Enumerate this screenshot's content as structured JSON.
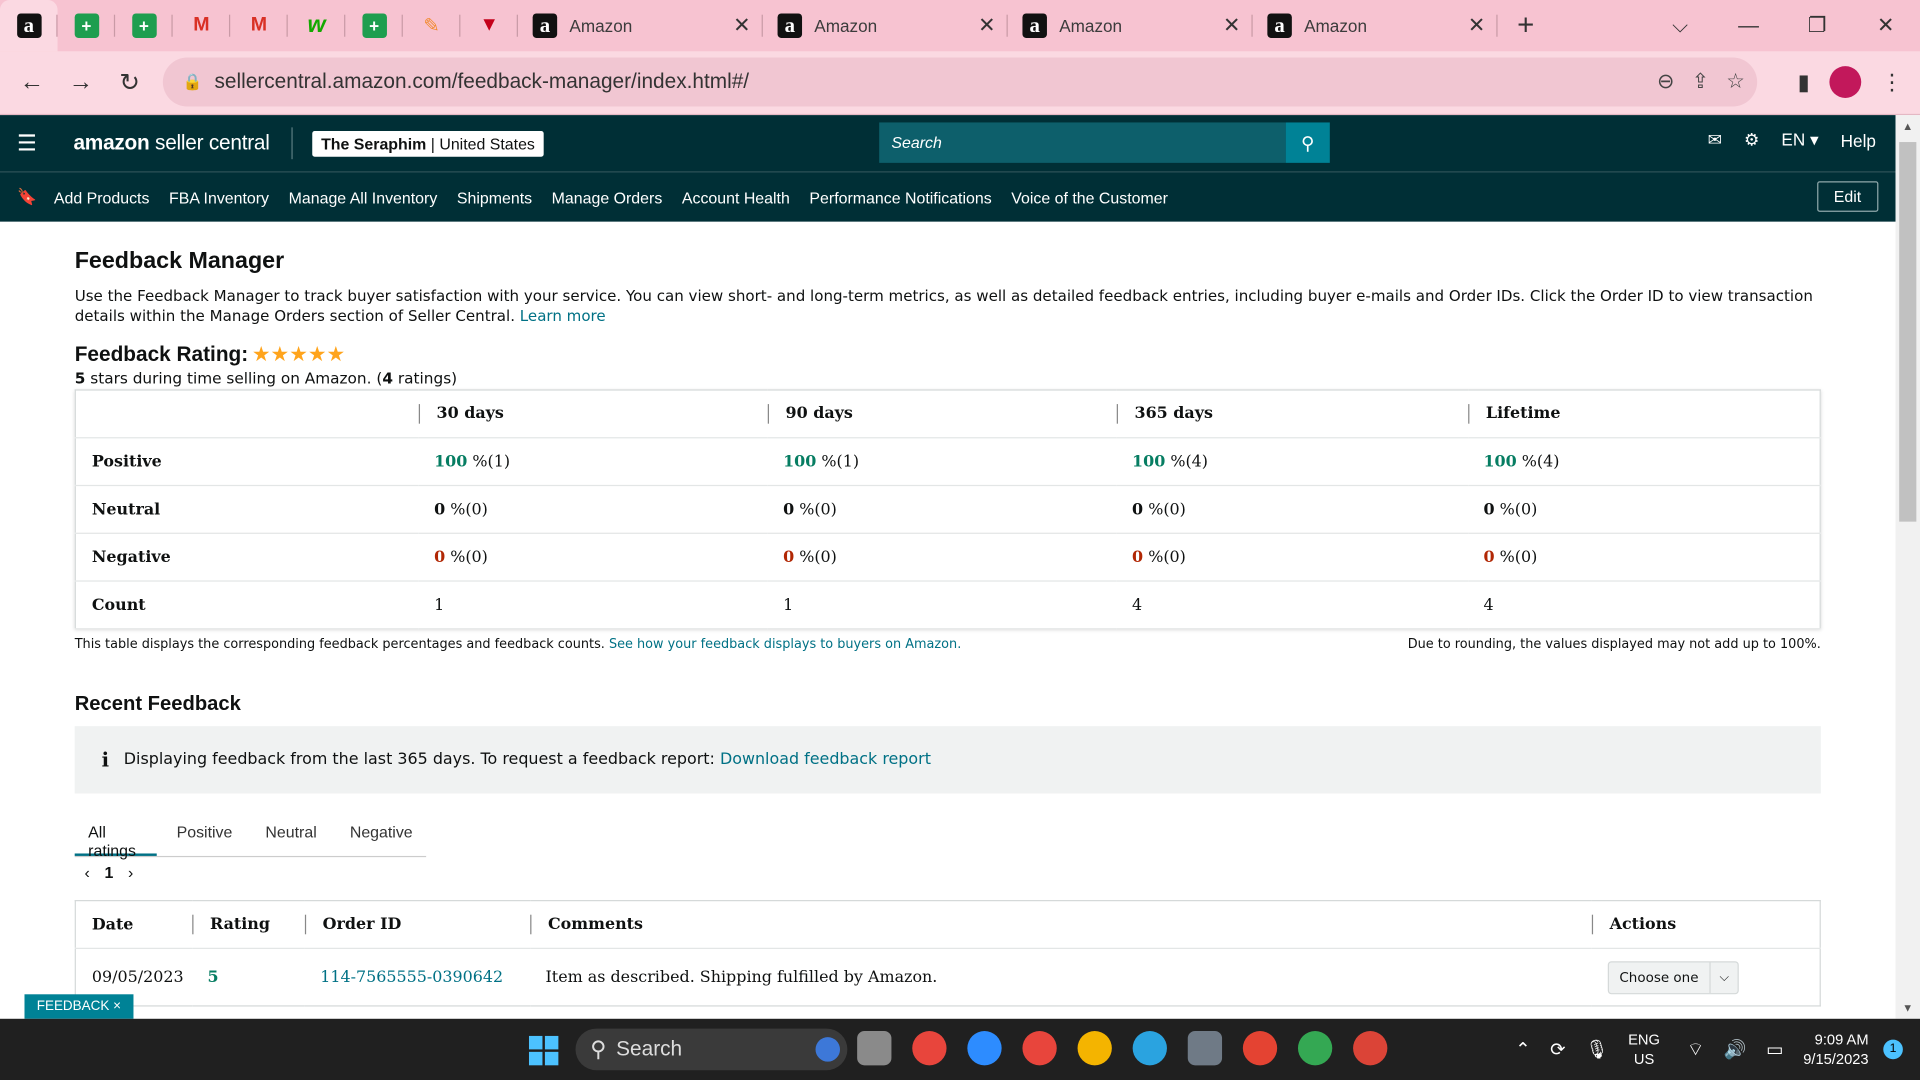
{
  "browser": {
    "tabs": [
      "Amazon",
      "Amazon",
      "Amazon",
      "Amazon"
    ],
    "url": "sellercentral.amazon.com/feedback-manager/index.html#/"
  },
  "header": {
    "logo_brand": "amazon",
    "logo_product": "seller central",
    "account_name": "The Seraphim",
    "account_region": "United States",
    "search_placeholder": "Search",
    "lang": "EN",
    "help": "Help"
  },
  "subnav": {
    "links": [
      "Add Products",
      "FBA Inventory",
      "Manage All Inventory",
      "Shipments",
      "Manage Orders",
      "Account Health",
      "Performance Notifications",
      "Voice of the Customer"
    ],
    "edit": "Edit"
  },
  "page": {
    "title": "Feedback Manager",
    "description": "Use the Feedback Manager to track buyer satisfaction with your service. You can view short- and long-term metrics, as well as detailed feedback entries, including buyer e-mails and Order IDs. Click the Order ID to view transaction details within the Manage Orders section of Seller Central.",
    "learn_more": "Learn more",
    "rating_label": "Feedback Rating:",
    "stars": "★★★★★",
    "rating_sub_stars": "5",
    "rating_sub_text": " stars during time selling on Amazon. (",
    "rating_sub_count": "4",
    "rating_sub_end": " ratings)"
  },
  "summary_table": {
    "columns": [
      "30 days",
      "90 days",
      "365 days",
      "Lifetime"
    ],
    "rows": [
      {
        "label": "Positive",
        "cells": [
          [
            "100",
            " %(1)"
          ],
          [
            "100",
            " %(1)"
          ],
          [
            "100",
            " %(4)"
          ],
          [
            "100",
            " %(4)"
          ]
        ]
      },
      {
        "label": "Neutral",
        "cells": [
          [
            "0",
            " %(0)"
          ],
          [
            "0",
            " %(0)"
          ],
          [
            "0",
            " %(0)"
          ],
          [
            "0",
            " %(0)"
          ]
        ]
      },
      {
        "label": "Negative",
        "cells": [
          [
            "0",
            " %(0)"
          ],
          [
            "0",
            " %(0)"
          ],
          [
            "0",
            " %(0)"
          ],
          [
            "0",
            " %(0)"
          ]
        ]
      },
      {
        "label": "Count",
        "cells": [
          "1",
          "1",
          "4",
          "4"
        ]
      }
    ],
    "footnote_left": "This table displays the corresponding feedback percentages and feedback counts.",
    "footnote_link": "See how your feedback displays to buyers on Amazon.",
    "footnote_right": "Due to rounding, the values displayed may not add up to 100%."
  },
  "recent": {
    "title": "Recent Feedback",
    "info_text": "Displaying feedback from the last 365 days. To request a feedback report:",
    "info_link": "Download feedback report",
    "tabs": [
      "All ratings",
      "Positive",
      "Neutral",
      "Negative"
    ],
    "page": "1",
    "columns": [
      "Date",
      "Rating",
      "Order ID",
      "Comments",
      "Actions"
    ],
    "rows": [
      {
        "date": "09/05/2023",
        "rating": "5",
        "order_id": "114-7565555-0390642",
        "comment": "Item as described. Shipping fulfilled by Amazon.",
        "action": "Choose one"
      }
    ]
  },
  "feedback_badge": "FEEDBACK ×",
  "taskbar": {
    "search": "Search",
    "lang_top": "ENG",
    "lang_bottom": "US",
    "time": "9:09 AM",
    "date": "9/15/2023",
    "notifications": "1"
  },
  "colors": {
    "header_bg": "#002f36",
    "positive": "#067d62",
    "negative": "#b12704",
    "link": "#007185",
    "tab_strip": "#f7c3d1"
  }
}
